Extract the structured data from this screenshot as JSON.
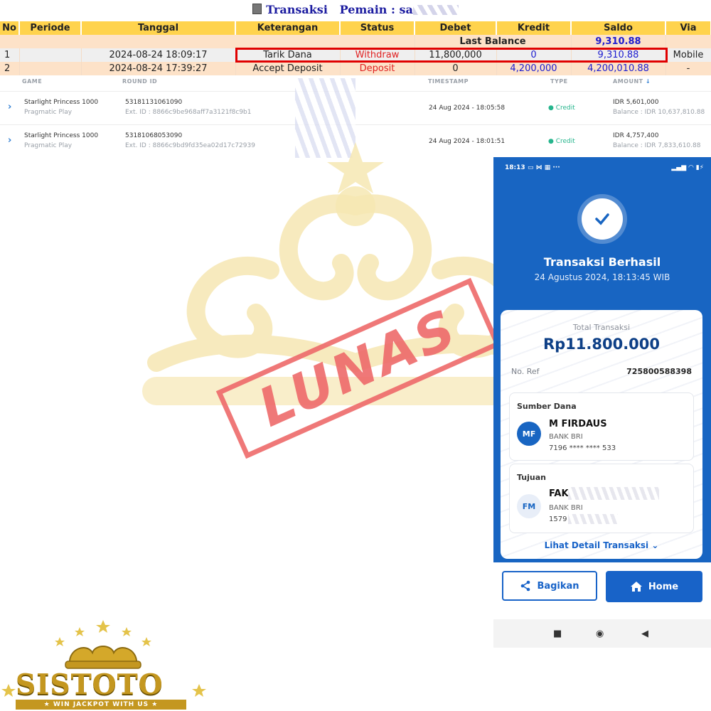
{
  "header": {
    "title_label": "Transaksi",
    "player_label": "Pemain : sa"
  },
  "table": {
    "columns": [
      "No",
      "Periode",
      "Tanggal",
      "Keterangan",
      "Status",
      "Debet",
      "Kredit",
      "Saldo",
      "Via"
    ],
    "last_balance_label": "Last Balance",
    "last_balance_value": "9,310.88",
    "rows": [
      {
        "no": "1",
        "periode": "",
        "tanggal": "2024-08-24 18:09:17",
        "keterangan": "Tarik Dana",
        "status": "Withdraw",
        "debet": "11,800,000",
        "kredit": "0",
        "saldo": "9,310.88",
        "via": "Mobile"
      },
      {
        "no": "2",
        "periode": "",
        "tanggal": "2024-08-24 17:39:27",
        "keterangan": "Accept Deposit",
        "status": "Deposit",
        "debet": "0",
        "kredit": "4,200,000",
        "saldo": "4,200,010.88",
        "via": "-"
      }
    ]
  },
  "game_list": {
    "headers": {
      "game": "GAME",
      "round_id": "ROUND ID",
      "timestamp": "TIMESTAMP",
      "type": "TYPE",
      "amount": "AMOUNT"
    },
    "rows": [
      {
        "game": "Starlight Princess 1000",
        "provider": "Pragmatic Play",
        "round_id": "53181131061090",
        "ext_id": "Ext. ID : 8866c9be968aff7a3121f8c9b1",
        "timestamp": "24 Aug 2024 - 18:05:58",
        "type": "Credit",
        "amount": "IDR 5,601,000",
        "balance": "Balance : IDR 10,637,810.88"
      },
      {
        "game": "Starlight Princess 1000",
        "provider": "Pragmatic Play",
        "round_id": "53181068053090",
        "ext_id": "Ext. ID : 8866c9bd9fd35ea02d17c72939",
        "timestamp": "24 Aug 2024 - 18:01:51",
        "type": "Credit",
        "amount": "IDR 4,757,400",
        "balance": "Balance : IDR 7,833,610.88"
      }
    ]
  },
  "stamp": "LUNAS",
  "phone": {
    "status_time": "18:13",
    "title": "Transaksi Berhasil",
    "datetime": "24 Agustus 2024, 18:13:45 WIB",
    "total_label": "Total Transaksi",
    "total_amount": "Rp11.800.000",
    "ref_label": "No. Ref",
    "ref_value": "725800588398",
    "source_label": "Sumber Dana",
    "source_initials": "MF",
    "source_name": "M FIRDAUS",
    "source_bank": "BANK BRI",
    "source_account": "7196 **** **** 533",
    "dest_label": "Tujuan",
    "dest_initials": "FM",
    "dest_name": "FAK",
    "dest_bank": "BANK BRI",
    "dest_account": "1579",
    "detail_link": "Lihat Detail Transaksi",
    "share_button": "Bagikan",
    "home_button": "Home"
  },
  "logo": {
    "brand": "SISTOTO",
    "tagline": "WIN JACKPOT WITH US"
  },
  "colors": {
    "header_bg": "#ffd34d",
    "highlight_border": "#e00000",
    "stamp": "#ee6a6a",
    "phone_blue": "#1865c2",
    "gold": "#c49720"
  }
}
